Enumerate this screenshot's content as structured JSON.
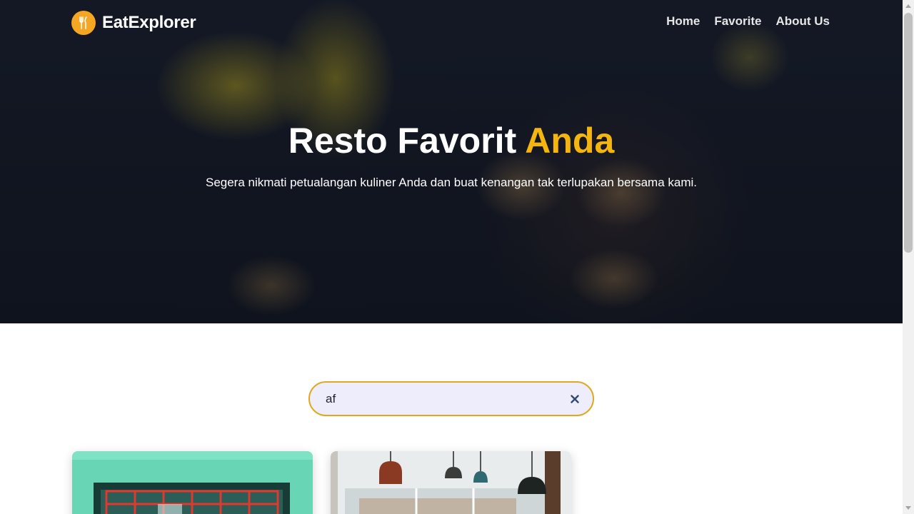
{
  "brand": {
    "name": "EatExplorer",
    "logo_icon": "fork-knife-icon",
    "accent_color": "#f5b50f"
  },
  "nav": {
    "items": [
      {
        "label": "Home"
      },
      {
        "label": "Favorite"
      },
      {
        "label": "About Us"
      }
    ]
  },
  "hero": {
    "title_main": "Resto Favorit",
    "title_accent": "Anda",
    "subtitle": "Segera nikmati petualangan kuliner Anda dan buat kenangan tak terlupakan bersama kami."
  },
  "search": {
    "value": "af",
    "clear_icon": "close-icon",
    "border_color": "#e0a81e"
  },
  "cards": [
    {
      "image": "restaurant-storefront-image"
    },
    {
      "image": "restaurant-interior-image"
    }
  ]
}
